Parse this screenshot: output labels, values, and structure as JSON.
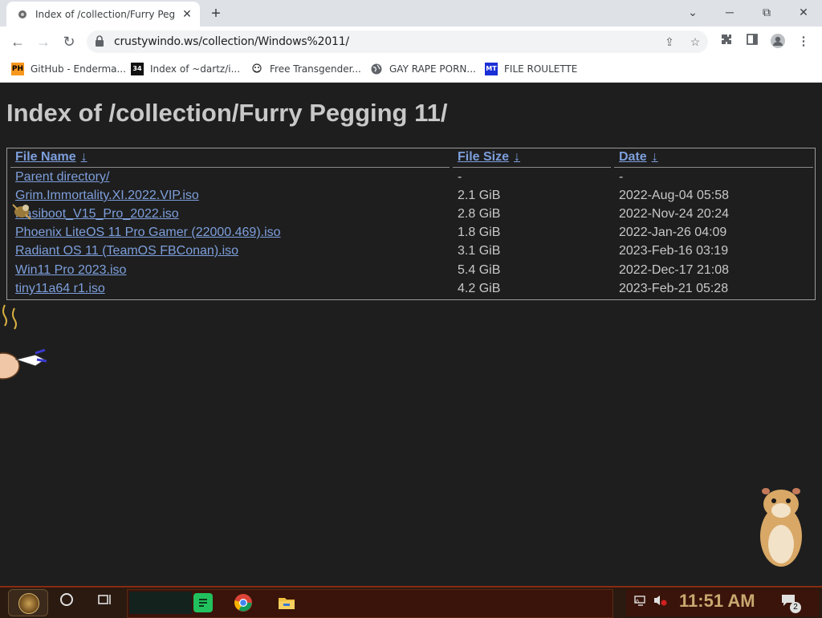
{
  "browser": {
    "tab_title": "Index of /collection/Furry Peg",
    "tab_close": "✕",
    "new_tab": "+",
    "url": "crustywindo.ws/collection/Windows%2011/",
    "win_min": "─",
    "win_max": "⧉",
    "win_close": "✕",
    "chevron": "⌄"
  },
  "bookmarks": [
    {
      "icon_text": "PH",
      "label": "GitHub - Enderma..."
    },
    {
      "icon_text": "34",
      "label": "Index of ~dartz/i..."
    },
    {
      "icon_text": "",
      "label": "Free Transgender..."
    },
    {
      "icon_text": "",
      "label": "GAY RAPE PORN..."
    },
    {
      "icon_text": "MT",
      "label": "FILE ROULETTE"
    }
  ],
  "page": {
    "heading": "Index of /collection/Furry Pegging 11/",
    "columns": [
      {
        "label": "File Name",
        "sort": "↓"
      },
      {
        "label": "File Size",
        "sort": "↓"
      },
      {
        "label": "Date",
        "sort": "↓"
      }
    ],
    "rows": [
      {
        "name": "Parent directory/",
        "size": "-",
        "date": "-"
      },
      {
        "name": "Grim.Immortality.XI.2022.VIP.iso",
        "size": "2.1 GiB",
        "date": "2022-Aug-04 05:58"
      },
      {
        "name": "Hasiboot_V15_Pro_2022.iso",
        "size": "2.8 GiB",
        "date": "2022-Nov-24 20:24"
      },
      {
        "name": "Phoenix LiteOS 11 Pro Gamer (22000.469).iso",
        "size": "1.8 GiB",
        "date": "2022-Jan-26 04:09"
      },
      {
        "name": "Radiant OS 11 (TeamOS FBConan).iso",
        "size": "3.1 GiB",
        "date": "2023-Feb-16 03:19"
      },
      {
        "name": "Win11 Pro 2023.iso",
        "size": "5.4 GiB",
        "date": "2022-Dec-17 21:08"
      },
      {
        "name": "tiny11a64 r1.iso",
        "size": "4.2 GiB",
        "date": "2023-Feb-21 05:28"
      }
    ]
  },
  "taskbar": {
    "clock": "11:51 AM",
    "notification_count": "2"
  },
  "colors": {
    "page_bg": "#1e1e1e",
    "link": "#7d9fdc",
    "text": "#c8c8c8"
  }
}
